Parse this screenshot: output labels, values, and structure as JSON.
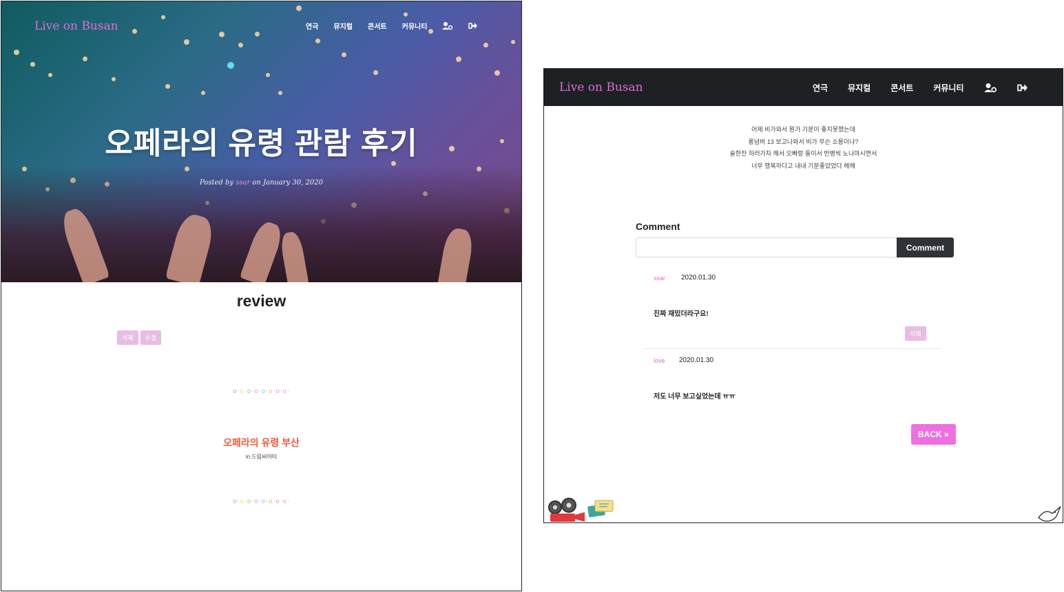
{
  "left": {
    "brand": "Live on Busan",
    "nav": [
      "연극",
      "뮤지컬",
      "콘서트",
      "커뮤니티"
    ],
    "hero_title": "오페라의 유령 관람 후기",
    "meta": {
      "prefix": "Posted by ",
      "author": "ssar",
      "suffix": " on January 30, 2020"
    },
    "review_heading": "review",
    "actions": {
      "delete": "삭제",
      "edit": "수정"
    },
    "content_heading": "오페라의 유령 부산",
    "content_sub": "in.드림씨어터",
    "dots": "o·o·o·o·o·o·o·o·"
  },
  "right": {
    "brand": "Live on Busan",
    "nav": [
      "연극",
      "뮤지컬",
      "콘서트",
      "커뮤니티"
    ],
    "body_lines": [
      "어제 비가와서 뭔가 기분이 좋지못했는데",
      "롱넘버 13 보고나와서 비가 무슨 소용이냐?",
      "술한잔 하러가자 해서 오빠랑 둘이서 반병씩 노나마시면서",
      "너무 행복하다고 내내 기분좋았었다 헤헤"
    ],
    "comment_label": "Comment",
    "comment_button": "Comment",
    "comments": [
      {
        "author": "ssar",
        "date": "2020.01.30",
        "text": "진짜 재밌더라구요!",
        "delete": "삭제"
      },
      {
        "author": "love",
        "date": "2020.01.30",
        "text": "저도 너무 보고싶었는데 ㅠㅠ"
      }
    ],
    "back": "BACK »"
  },
  "colors": {
    "accent": "#e06bd6",
    "nav_bg": "#1e2124",
    "heading_red": "#f05a3a",
    "back_btn": "#f06fe0"
  },
  "icons": [
    "user-cog-icon",
    "sign-out-icon",
    "projector-icon",
    "tickets-icon",
    "bird-icon"
  ]
}
